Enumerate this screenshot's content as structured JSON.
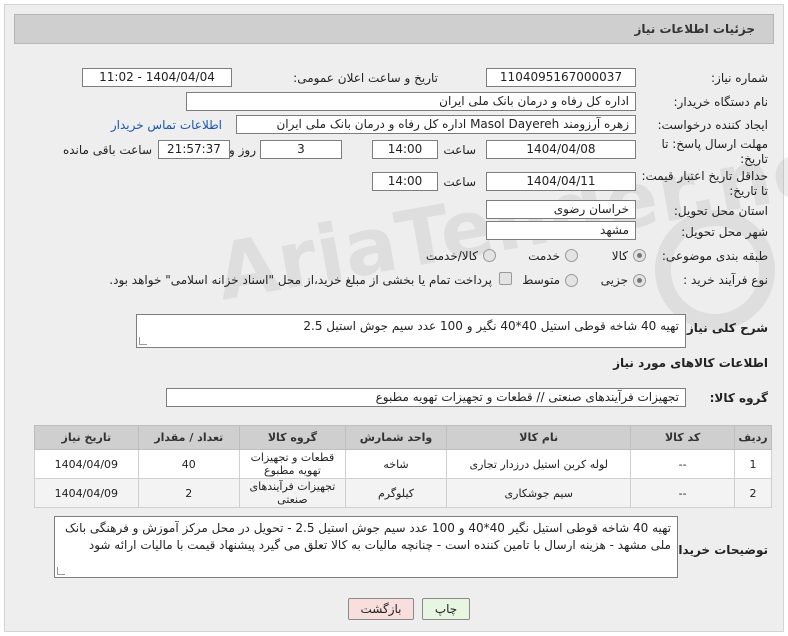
{
  "header": {
    "title": "جزئیات اطلاعات نیاز"
  },
  "fields": {
    "need_number_label": "شماره نیاز:",
    "need_number": "1104095167000037",
    "announce_label": "تاریخ و ساعت اعلان عمومی:",
    "announce_value": "1404/04/04 - 11:02",
    "buyer_org_label": "نام دستگاه خریدار:",
    "buyer_org": "اداره کل رفاه و درمان بانک ملی ایران",
    "creator_label": "ایجاد کننده درخواست:",
    "creator": "زهره آرزومند Masol Dayereh اداره کل رفاه و درمان بانک ملی ایران",
    "contact_link": "اطلاعات تماس خریدار",
    "deadline_label_1": "مهلت ارسال پاسخ: تا",
    "deadline_label_2": "تاریخ:",
    "deadline_date": "1404/04/08",
    "time_label": "ساعت",
    "deadline_time": "14:00",
    "days_value": "3",
    "days_label": "روز و",
    "remaining_time": "21:57:37",
    "remaining_label": "ساعت باقی مانده",
    "min_validity_label_1": "حداقل تاریخ اعتبار قیمت:",
    "min_validity_label_2": "تا تاریخ:",
    "validity_date": "1404/04/11",
    "validity_time": "14:00",
    "province_label": "استان محل تحویل:",
    "province": "خراسان رضوی",
    "city_label": "شهر محل تحویل:",
    "city": "مشهد",
    "category_label": "طبقه بندی موضوعی:",
    "category_options": [
      "کالا",
      "خدمت",
      "کالا/خدمت"
    ],
    "process_label": "نوع فرآیند خرید :",
    "process_options": [
      "جزیی",
      "متوسط"
    ],
    "payment_note": "پرداخت تمام یا بخشی از مبلغ خرید،از محل \"اسناد خزانه اسلامی\" خواهد بود."
  },
  "description": {
    "label": "شرح کلی نیاز:",
    "text": "تهیه 40 شاخه قوطی استیل 40*40 نگیر و 100 عدد سیم جوش استیل 2.5"
  },
  "goods_section": {
    "title": "اطلاعات کالاهای مورد نیاز",
    "group_label": "گروه کالا:",
    "group_value": "تجهیزات فرآیندهای صنعتی //  قطعات و تجهیزات تهویه مطبوع"
  },
  "table": {
    "headers": [
      "ردیف",
      "کد کالا",
      "نام کالا",
      "واحد شمارش",
      "گروه کالا",
      "تعداد / مقدار",
      "تاریخ نیاز"
    ],
    "rows": [
      [
        "1",
        "--",
        "لوله کربن استیل درزدار تجاری",
        "شاخه",
        "قطعات و تجهیزات تهویه مطبوع",
        "40",
        "1404/04/09"
      ],
      [
        "2",
        "--",
        "سیم جوشکاری",
        "کیلوگرم",
        "تجهیزات فرآیندهای صنعتی",
        "2",
        "1404/04/09"
      ]
    ]
  },
  "buyer_notes": {
    "label": "توضیحات خریدار:",
    "text": "تهیه 40 شاخه قوطی استیل نگیر 40*40 و 100 عدد سیم جوش استیل 2.5 - تحویل در محل مرکز آموزش و فرهنگی بانک ملی مشهد - هزینه ارسال با تامین کننده است - چنانچه مالیات به کالا تعلق می گیرد پیشنهاد قیمت با مالیات ارائه شود"
  },
  "buttons": {
    "print": "چاپ",
    "back": "بازگشت"
  },
  "watermark": "AriaTender.net",
  "colors": {
    "header_bg": "#cfcfcf",
    "link": "#1a55b0",
    "print_btn": "#e8f5e0",
    "back_btn": "#f9dede"
  }
}
